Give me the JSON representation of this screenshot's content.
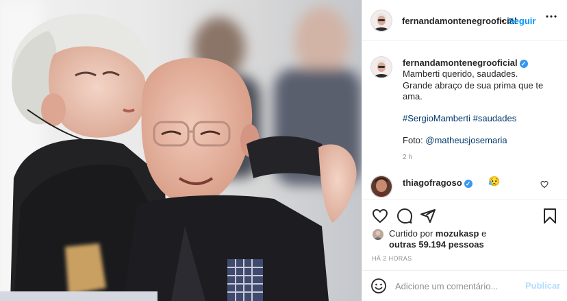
{
  "post": {
    "account": "fernandamontenegrooficial",
    "separator": "•",
    "follow_label": "Seguir",
    "more_icon": "more-horizontal-icon",
    "photo_alt": "Fernanda Montenegro beija a cabeça de Sergio Mamberti"
  },
  "caption": {
    "username": "fernandamontenegrooficial",
    "verified_icon": "verified-badge-icon",
    "line1": "Mamberti querido, saudades.",
    "line2": "Grande abraço de sua prima que te",
    "line3": "ama.",
    "hashtag1": "#SergioMamberti",
    "hashtag2": "#saudades",
    "photo_credit_prefix": "Foto: ",
    "photo_credit_handle": "@matheusjosemaria",
    "time": "2 h"
  },
  "comment": {
    "username": "thiagofragoso",
    "emoji": "😥",
    "heart_icon": "heart-outline-icon"
  },
  "actions": {
    "like_icon": "heart-outline-icon",
    "comment_icon": "comment-icon",
    "share_icon": "paper-plane-icon",
    "save_icon": "bookmark-icon"
  },
  "likes": {
    "prefix": "Curtido por ",
    "user": "mozukasp",
    "and": " e",
    "others": "outras 59.194 pessoas"
  },
  "posted_ago": "HÁ 2 HORAS",
  "add_comment": {
    "placeholder": "Adicione um comentário...",
    "publish_label": "Publicar",
    "emoji_icon": "smiley-icon"
  },
  "colors": {
    "link_blue": "#0095f6",
    "hashtag_blue": "#00376b",
    "muted_gray": "#8e8e8e",
    "publish_disabled": "#b2dffc",
    "border": "#efefef"
  }
}
